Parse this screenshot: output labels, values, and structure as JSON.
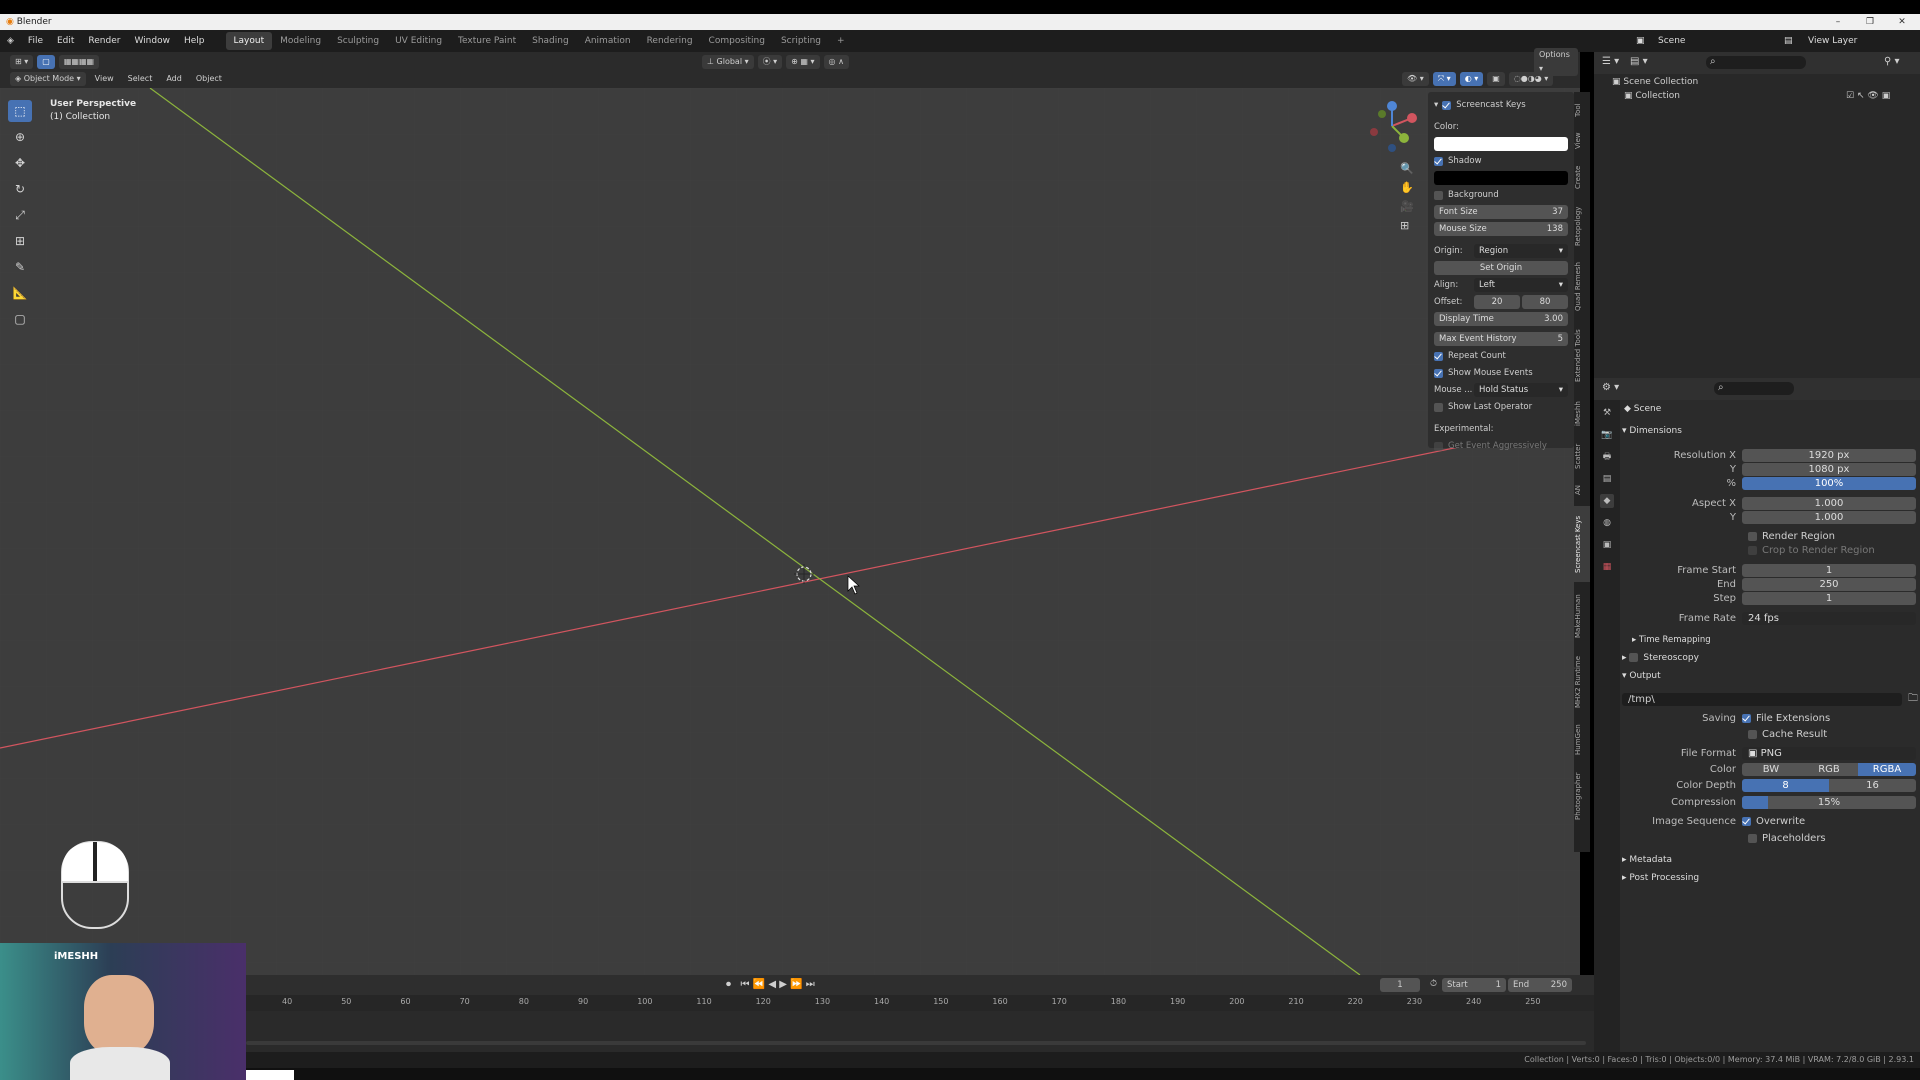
{
  "window": {
    "title": "Blender"
  },
  "menu": {
    "items": [
      "File",
      "Edit",
      "Render",
      "Window",
      "Help"
    ]
  },
  "workspaces": [
    "Layout",
    "Modeling",
    "Sculpting",
    "UV Editing",
    "Texture Paint",
    "Shading",
    "Animation",
    "Rendering",
    "Compositing",
    "Scripting"
  ],
  "active_workspace": "Layout",
  "topbar_right": {
    "scene_label": "Scene",
    "viewlayer_label": "View Layer"
  },
  "viewport_header": {
    "mode": "Object Mode",
    "menus": [
      "View",
      "Select",
      "Add",
      "Object"
    ],
    "transform_orientation": "Global",
    "options": "Options"
  },
  "viewport_info": {
    "line1": "User Perspective",
    "line2": "(1) Collection"
  },
  "screencast_panel": {
    "title": "Screencast Keys",
    "color_label": "Color:",
    "shadow_label": "Shadow",
    "background_label": "Background",
    "font_size_label": "Font Size",
    "font_size_value": "37",
    "mouse_size_label": "Mouse Size",
    "mouse_size_value": "138",
    "origin_label": "Origin:",
    "origin_value": "Region",
    "set_origin_label": "Set Origin",
    "align_label": "Align:",
    "align_value": "Left",
    "offset_label": "Offset:",
    "offset_x": "20",
    "offset_y": "80",
    "display_time_label": "Display Time",
    "display_time_value": "3.00",
    "max_event_label": "Max Event History",
    "max_event_value": "5",
    "repeat_count_label": "Repeat Count",
    "show_mouse_label": "Show Mouse Events",
    "mouse_label": "Mouse ...",
    "mouse_value": "Hold Status",
    "show_last_label": "Show Last Operator",
    "experimental_label": "Experimental:",
    "get_event_label": "Get Event Aggressively"
  },
  "sidebar_tabs": [
    "Tool",
    "View",
    "Create",
    "Retopology",
    "Quad Remesh",
    "Extended Tools",
    "iMeshh",
    "Scatter",
    "AN",
    "Screencast Keys",
    "MakeHuman",
    "MHX2 Runtime",
    "HumGen",
    "Photographer"
  ],
  "outliner": {
    "scene_collection": "Scene Collection",
    "collection": "Collection"
  },
  "properties": {
    "context": "Scene",
    "dimensions_label": "Dimensions",
    "resolution_x_label": "Resolution X",
    "resolution_x": "1920 px",
    "resolution_y_label": "Y",
    "resolution_y": "1080 px",
    "percent_label": "%",
    "percent": "100%",
    "aspect_x_label": "Aspect X",
    "aspect_x": "1.000",
    "aspect_y_label": "Y",
    "aspect_y": "1.000",
    "render_region_label": "Render Region",
    "crop_label": "Crop to Render Region",
    "frame_start_label": "Frame Start",
    "frame_start": "1",
    "end_label": "End",
    "end": "250",
    "step_label": "Step",
    "step": "1",
    "frame_rate_label": "Frame Rate",
    "frame_rate": "24 fps",
    "time_remapping_label": "Time Remapping",
    "stereoscopy_label": "Stereoscopy",
    "output_label": "Output",
    "output_path": "/tmp\\",
    "saving_label": "Saving",
    "file_ext_label": "File Extensions",
    "cache_label": "Cache Result",
    "file_format_label": "File Format",
    "file_format": "PNG",
    "color_label": "Color",
    "color_opts": [
      "BW",
      "RGB",
      "RGBA"
    ],
    "color_depth_label": "Color Depth",
    "color_depth_opts": [
      "8",
      "16"
    ],
    "compression_label": "Compression",
    "compression": "15%",
    "compression_fraction": 0.15,
    "image_seq_label": "Image Sequence",
    "overwrite_label": "Overwrite",
    "placeholders_label": "Placeholders",
    "metadata_label": "Metadata",
    "post_label": "Post Processing"
  },
  "timeline": {
    "current_frame": "1",
    "start_label": "Start",
    "start": "1",
    "end_label": "End",
    "end": "250",
    "ticks": [
      "40",
      "50",
      "60",
      "70",
      "80",
      "90",
      "100",
      "110",
      "120",
      "130",
      "140",
      "150",
      "160",
      "170",
      "180",
      "190",
      "200",
      "210",
      "220",
      "230",
      "240",
      "250"
    ]
  },
  "statusbar": {
    "text": "Collection | Verts:0 | Faces:0 | Tris:0 | Objects:0/0 | Memory: 37.4 MiB | VRAM: 7.2/8.0 GiB | 2.93.1"
  },
  "webcam": {
    "logo": "iMESHH"
  },
  "colors": {
    "accent": "#4772b3",
    "x_axis": "#d2555f",
    "y_axis": "#8cb43c",
    "viewport_bg": "#3d3d3d"
  }
}
